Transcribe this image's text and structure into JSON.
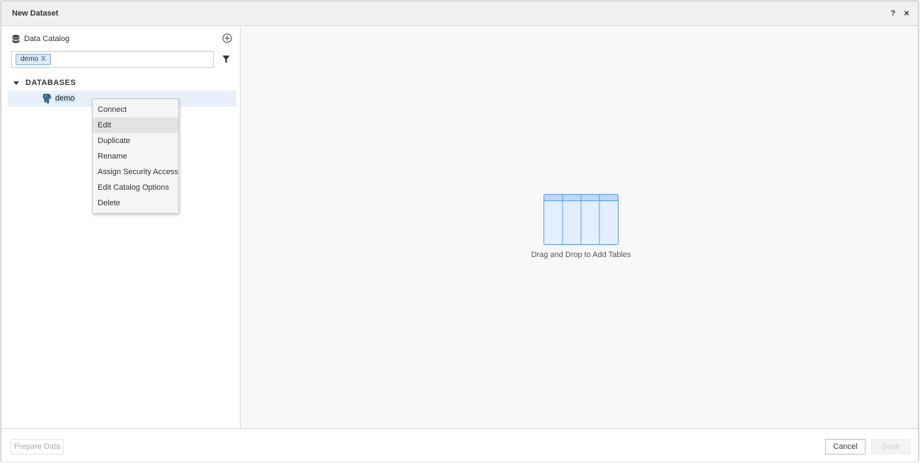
{
  "dialog": {
    "title": "New Dataset",
    "help_label": "?",
    "close_label": "×"
  },
  "catalog": {
    "title": "Data Catalog",
    "search_chip": {
      "label": "demo",
      "remove_label": "X"
    },
    "section_label": "DATABASES",
    "databases": [
      {
        "label": "demo",
        "selected": true
      }
    ]
  },
  "context_menu": {
    "items": [
      {
        "label": "Connect"
      },
      {
        "label": "Edit",
        "hover": true
      },
      {
        "label": "Duplicate"
      },
      {
        "label": "Rename"
      },
      {
        "label": "Assign Security Access"
      },
      {
        "label": "Edit Catalog Options"
      },
      {
        "label": "Delete"
      }
    ]
  },
  "canvas": {
    "empty_message": "Drag and Drop to Add Tables"
  },
  "footer": {
    "prepare_label": "Prepare Data",
    "cancel_label": "Cancel",
    "save_label": "Save"
  },
  "colors": {
    "accent": "#7faee2",
    "selected_row": "#e8f1fb",
    "canvas_bg": "#f8f8f8"
  },
  "icons": {
    "catalog": "database-icon",
    "add": "plus-circle-icon",
    "filter": "filter-icon",
    "expand": "caret-down-icon",
    "database": "postgresql-elephant-icon"
  }
}
